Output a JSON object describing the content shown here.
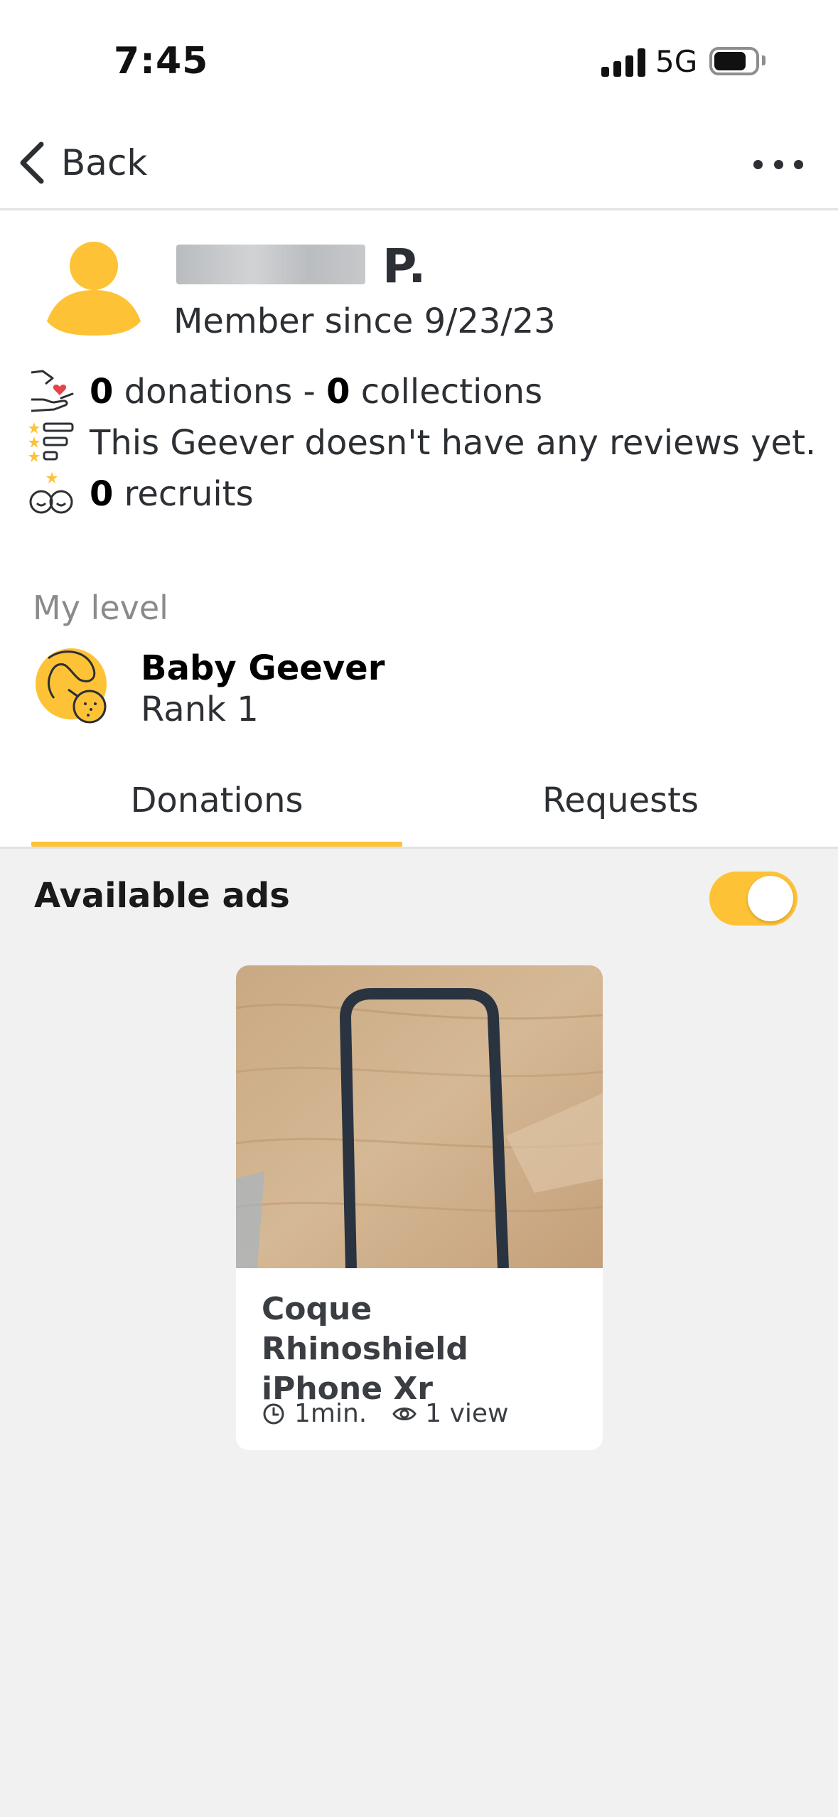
{
  "status_bar": {
    "time": "7:45",
    "network": "5G"
  },
  "nav": {
    "back_label": "Back"
  },
  "profile": {
    "name_suffix": "P.",
    "member_since": "Member since 9/23/23",
    "stats": {
      "donations_count": "0",
      "donations_word": " donations - ",
      "collections_count": "0",
      "collections_word": " collections",
      "reviews_text": "This Geever doesn't have any reviews yet.",
      "recruits_count": "0",
      "recruits_word": " recruits"
    },
    "level": {
      "label": "My level",
      "name": "Baby Geever",
      "rank": "Rank 1"
    }
  },
  "tabs": [
    {
      "label": "Donations",
      "active": true
    },
    {
      "label": "Requests",
      "active": false
    }
  ],
  "ads": {
    "available_label": "Available ads",
    "toggle_on": true,
    "items": [
      {
        "title": "Coque Rhinoshield iPhone Xr",
        "age": "1min.",
        "views": "1 view"
      }
    ]
  },
  "colors": {
    "accent": "#fdc236",
    "text": "#2c2f33",
    "list_background": "#f1f1f1"
  },
  "icons": [
    "chevron-left-icon",
    "more-dots-icon",
    "avatar-icon",
    "donation-hand-icon",
    "reviews-icon",
    "recruits-icon",
    "pacifier-badge-icon",
    "clock-icon",
    "eye-icon"
  ]
}
